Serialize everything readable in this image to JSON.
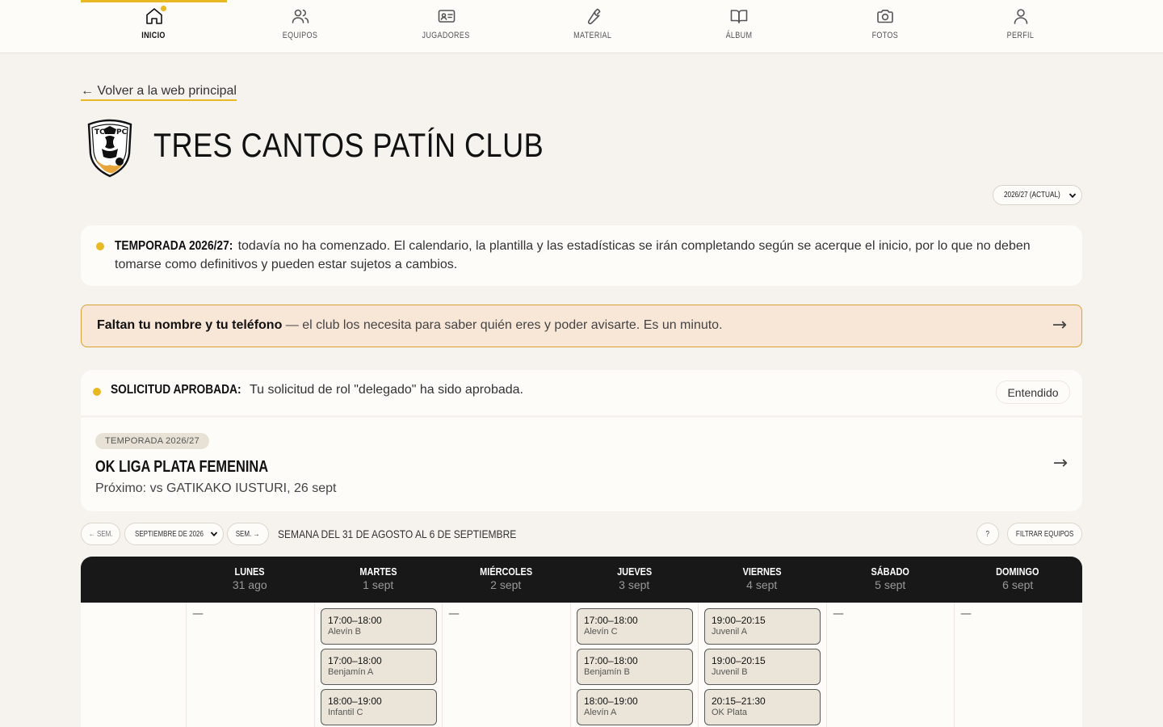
{
  "nav": [
    {
      "label": "Inicio",
      "icon": "home-icon",
      "active": true
    },
    {
      "label": "Equipos",
      "icon": "users-icon"
    },
    {
      "label": "Jugadores",
      "icon": "id-card-icon"
    },
    {
      "label": "Material",
      "icon": "wrench-icon"
    },
    {
      "label": "Álbum",
      "icon": "book-icon"
    },
    {
      "label": "Fotos",
      "icon": "camera-icon"
    },
    {
      "label": "Perfil",
      "icon": "user-icon"
    }
  ],
  "back_link": "← Volver a la web principal",
  "club": {
    "name": "TRES CANTOS PATÍN CLUB"
  },
  "season_select": {
    "value": "2026/27 (ACTUAL)"
  },
  "season_notice": {
    "title": "TEMPORADA 2026/27:",
    "text": " todavía no ha comenzado. El calendario, la plantilla y las estadísticas se irán completando según se acerque el inicio, por lo que no deben tomarse como definitivos y pueden estar sujetos a cambios."
  },
  "profile_banner": {
    "bold": "Faltan tu nombre y tu teléfono",
    "text": " — el club los necesita para saber quién eres y poder avisarte. Es un minuto.",
    "arrow": "→"
  },
  "approved_notice": {
    "title": "SOLICITUD APROBADA:",
    "text": " Tu solicitud de rol \"delegado\" ha sido aprobada.",
    "button": "Entendido"
  },
  "competition": {
    "tag": "TEMPORADA 2026/27",
    "name": "OK LIGA PLATA FEMENINA",
    "next": "Próximo: vs GATIKAKO IUSTURI, 26 sept",
    "arrow": "→"
  },
  "calendar_controls": {
    "prev": "← SEM.",
    "month": "SEPTIEMBRE DE 2026",
    "next": "SEM. →",
    "week_label": "SEMANA DEL 31 DE AGOSTO AL 6 DE SEPTIEMBRE",
    "help": "?",
    "filter": "FILTRAR EQUIPOS"
  },
  "calendar": {
    "days": [
      {
        "name": "LUNES",
        "date": "31 ago",
        "slots": []
      },
      {
        "name": "MARTES",
        "date": "1 sept",
        "slots": [
          {
            "time": "17:00–18:00",
            "team": "Alevín B"
          },
          {
            "time": "17:00–18:00",
            "team": "Benjamín A"
          },
          {
            "time": "18:00–19:00",
            "team": "Infantil C"
          }
        ]
      },
      {
        "name": "MIÉRCOLES",
        "date": "2 sept",
        "slots": []
      },
      {
        "name": "JUEVES",
        "date": "3 sept",
        "slots": [
          {
            "time": "17:00–18:00",
            "team": "Alevín C"
          },
          {
            "time": "17:00–18:00",
            "team": "Benjamín B"
          },
          {
            "time": "18:00–19:00",
            "team": "Alevín A"
          }
        ]
      },
      {
        "name": "VIERNES",
        "date": "4 sept",
        "slots": [
          {
            "time": "19:00–20:15",
            "team": "Juvenil A"
          },
          {
            "time": "19:00–20:15",
            "team": "Juvenil B"
          },
          {
            "time": "20:15–21:30",
            "team": "OK Plata"
          }
        ]
      },
      {
        "name": "SÁBADO",
        "date": "5 sept",
        "slots": []
      },
      {
        "name": "DOMINGO",
        "date": "6 sept",
        "slots": []
      }
    ],
    "empty_mark": "—"
  },
  "colors": {
    "accent": "#e8b923",
    "header_dark": "#181818",
    "banner_bg": "#f8e6d7",
    "slot_bg": "#ebe5d9"
  }
}
